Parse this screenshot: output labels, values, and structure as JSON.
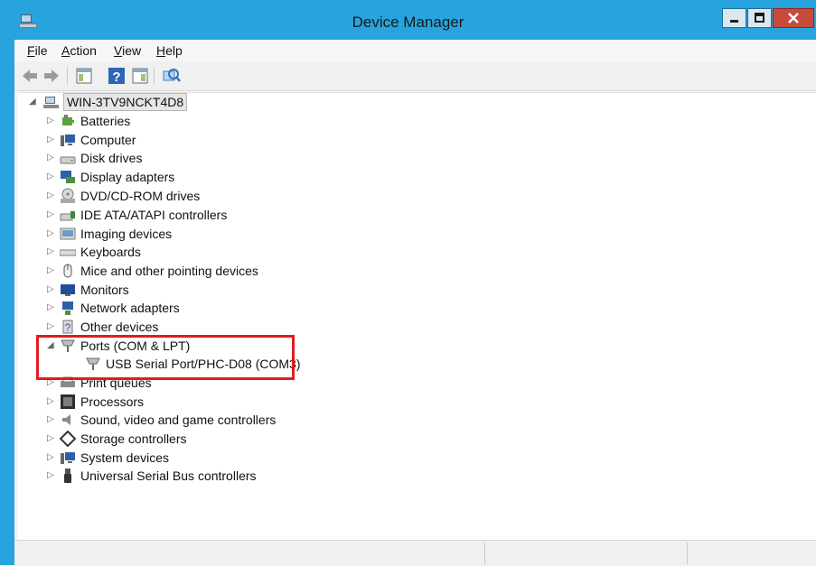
{
  "window": {
    "title": "Device Manager",
    "accent_color": "#27a4dd",
    "close_color": "#c74a3a"
  },
  "menu": [
    {
      "label": "File",
      "u": "F",
      "rest": "ile"
    },
    {
      "label": "Action",
      "u": "A",
      "rest": "ction"
    },
    {
      "label": "View",
      "u": "V",
      "rest": "iew"
    },
    {
      "label": "Help",
      "u": "H",
      "rest": "elp"
    }
  ],
  "toolbar": [
    "back-icon",
    "forward-icon",
    "properties-icon",
    "help-icon",
    "show-hide-console-tree-icon",
    "scan-hardware-changes-icon"
  ],
  "tree": {
    "root": "WIN-3TV9NCKT4D8",
    "categories": [
      {
        "label": "Batteries",
        "icon": "battery-icon",
        "expanded": false
      },
      {
        "label": "Computer",
        "icon": "computer-icon",
        "expanded": false
      },
      {
        "label": "Disk drives",
        "icon": "disk-drive-icon",
        "expanded": false
      },
      {
        "label": "Display adapters",
        "icon": "display-adapter-icon",
        "expanded": false
      },
      {
        "label": "DVD/CD-ROM drives",
        "icon": "dvd-drive-icon",
        "expanded": false
      },
      {
        "label": "IDE ATA/ATAPI controllers",
        "icon": "ide-controller-icon",
        "expanded": false
      },
      {
        "label": "Imaging devices",
        "icon": "imaging-device-icon",
        "expanded": false
      },
      {
        "label": "Keyboards",
        "icon": "keyboard-icon",
        "expanded": false
      },
      {
        "label": "Mice and other pointing devices",
        "icon": "mouse-icon",
        "expanded": false
      },
      {
        "label": "Monitors",
        "icon": "monitor-icon",
        "expanded": false
      },
      {
        "label": "Network adapters",
        "icon": "network-adapter-icon",
        "expanded": false
      },
      {
        "label": "Other devices",
        "icon": "other-devices-icon",
        "expanded": false
      },
      {
        "label": "Ports (COM & LPT)",
        "icon": "port-icon",
        "expanded": true
      },
      {
        "label": "Print queues",
        "icon": "printer-icon",
        "expanded": false
      },
      {
        "label": "Processors",
        "icon": "processor-icon",
        "expanded": false
      },
      {
        "label": "Sound, video and game controllers",
        "icon": "sound-icon",
        "expanded": false
      },
      {
        "label": "Storage controllers",
        "icon": "storage-controller-icon",
        "expanded": false
      },
      {
        "label": "System devices",
        "icon": "system-device-icon",
        "expanded": false
      },
      {
        "label": "Universal Serial Bus controllers",
        "icon": "usb-icon",
        "expanded": false
      }
    ],
    "port_child": "USB Serial Port/PHC-D08 (COM3)"
  },
  "highlight_color": "#e11b22"
}
